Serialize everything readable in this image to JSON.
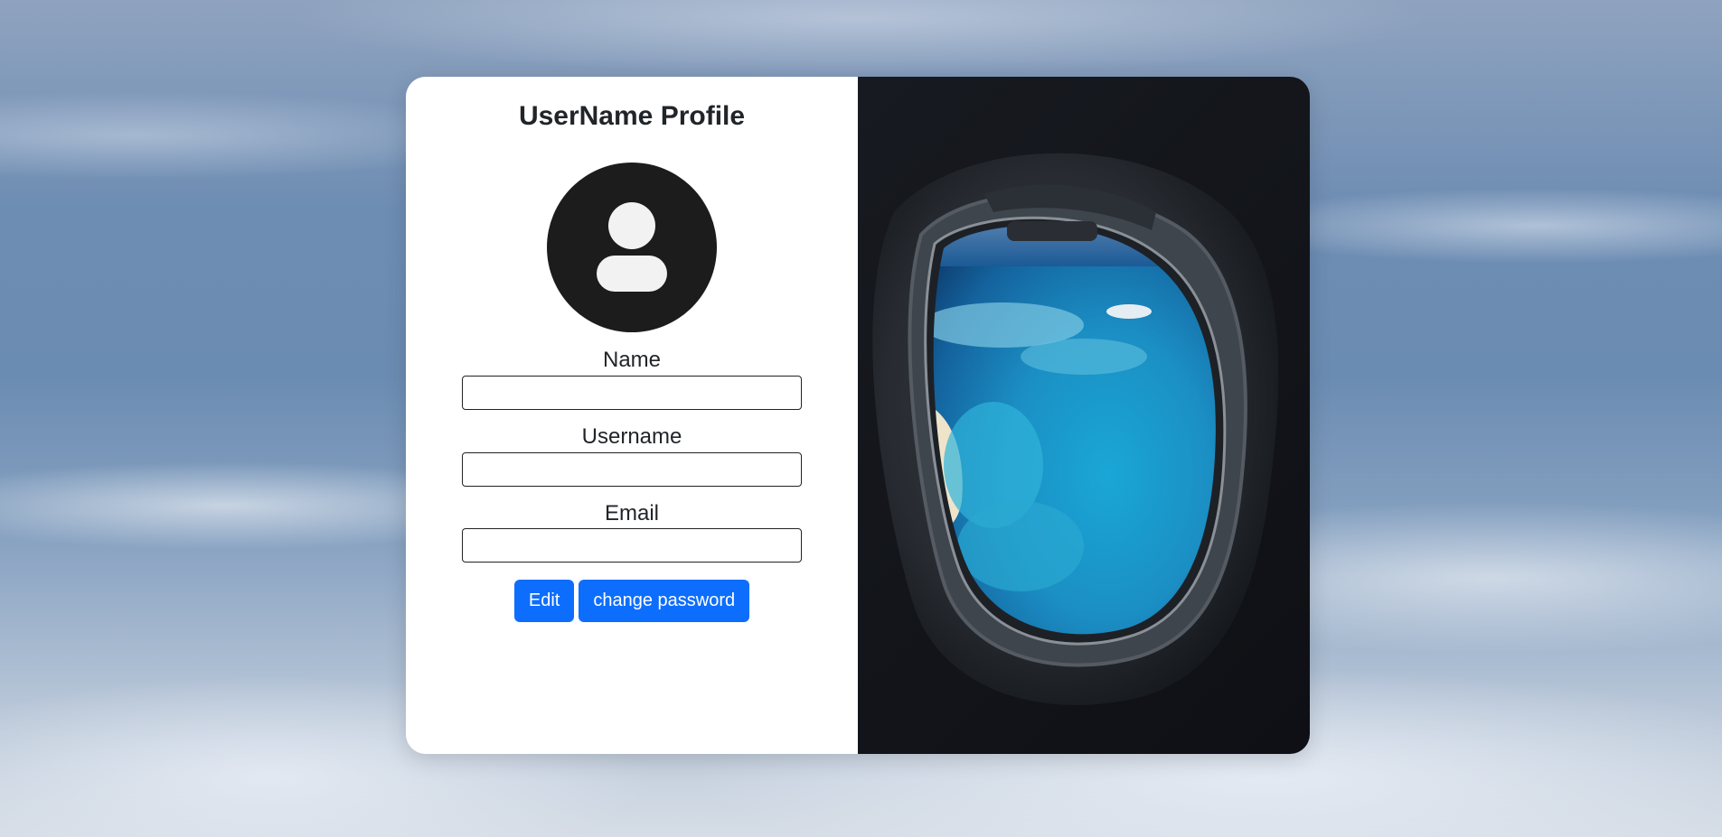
{
  "page": {
    "background": "sky-clouds-image"
  },
  "profile": {
    "title": "UserName Profile",
    "avatar_icon": "user-avatar-icon",
    "fields": {
      "name": {
        "label": "Name",
        "value": ""
      },
      "username": {
        "label": "Username",
        "value": ""
      },
      "email": {
        "label": "Email",
        "value": ""
      }
    },
    "buttons": {
      "edit": "Edit",
      "change_password": "change password"
    }
  },
  "side_image": {
    "subject": "airplane-window-ocean-reef"
  },
  "colors": {
    "primary_button": "#0d6efd",
    "avatar": "#1c1c1c",
    "card_left": "#ffffff",
    "card_right": "#121419"
  }
}
